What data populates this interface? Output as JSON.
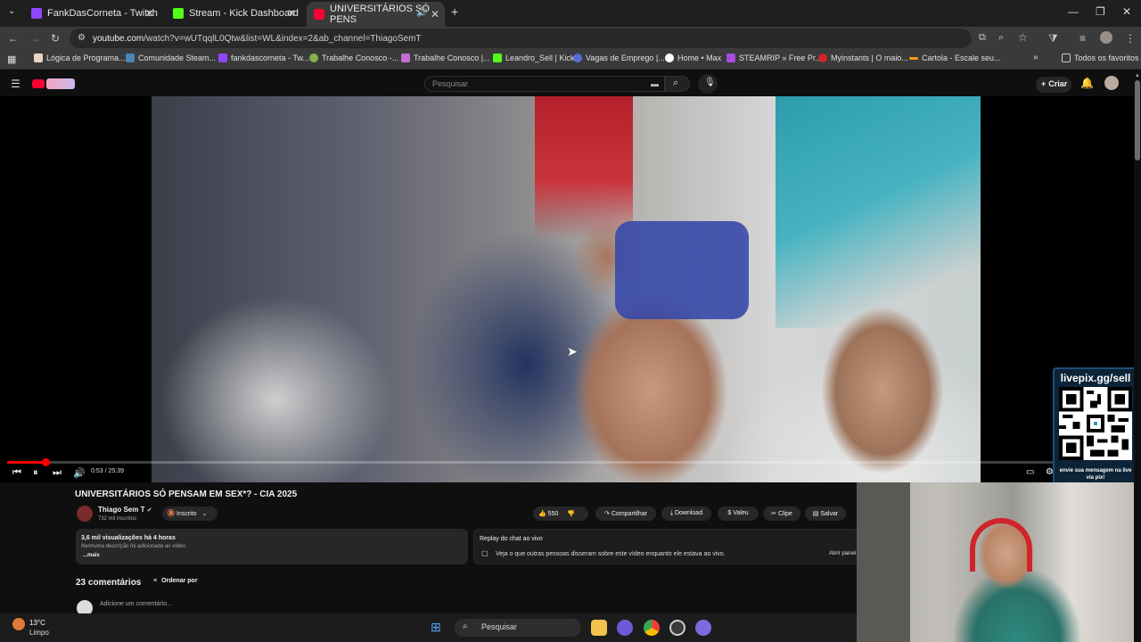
{
  "browser": {
    "tabs": [
      {
        "title": "FankDasCorneta - Twitch",
        "color": "#9146ff"
      },
      {
        "title": "Stream - Kick Dashboard",
        "color": "#53fc18"
      },
      {
        "title": "UNIVERSITÁRIOS SÓ PENS",
        "color": "#ff0033"
      }
    ],
    "new_tab": "+",
    "url_host": "youtube.com",
    "url_path": "/watch?v=wUTqqlL0Qtw&list=WL&index=2&ab_channel=ThiagoSemT",
    "bookmarks": [
      {
        "label": "Lógica de Programa...",
        "color": "#e6d8c0"
      },
      {
        "label": "Comunidade Steam...",
        "color": "#4b86b4"
      },
      {
        "label": "fankdascorneta - Tw...",
        "color": "#9146ff"
      },
      {
        "label": "Trabalhe Conosco -...",
        "color": "#7fb347"
      },
      {
        "label": "Trabalhe Conosco |...",
        "color": "#c26fd0"
      },
      {
        "label": "Leandro_Sell | Kick",
        "color": "#53fc18"
      },
      {
        "label": "Vagas de Emprego |...",
        "color": "#5b6bd6"
      },
      {
        "label": "Home • Max",
        "color": "#ffffff"
      },
      {
        "label": "STEAMRIP » Free Pr...",
        "color": "#a64de0"
      },
      {
        "label": "Myinstants | O maio...",
        "color": "#d0242a"
      },
      {
        "label": "Cartola - Escale seu...",
        "color": "#f39c12"
      }
    ],
    "all_bookmarks": "Todos os favoritos"
  },
  "youtube": {
    "search_placeholder": "Pesquisar",
    "create_label": "Criar"
  },
  "player": {
    "time": "0:53 / 25:39",
    "progress": 0.034
  },
  "overlay": {
    "livepix_title": "livepix.gg/sell",
    "livepix_sub": "envie sua mensagem na live via pix!"
  },
  "video": {
    "title": "UNIVERSITÁRIOS SÓ PENSAM EM SEX*? - CIA 2025",
    "channel": "Thiago Sem T",
    "subscribers": "732 mil inscritos",
    "subscribed_label": "Inscrito",
    "likes": "550",
    "share": "Compartilhar",
    "download": "Download",
    "thanks": "Valeu",
    "clip": "Clipe",
    "save": "Salvar",
    "views_time": "3,6 mil visualizações  há 4 horas",
    "description": "Nenhuma descrição foi adicionada ao vídeo.",
    "more": "...mais",
    "chat_replay_title": "Replay do chat ao vivo",
    "chat_replay_text": "Veja o que outras pessoas disseram sobre este vídeo enquanto ele estava ao vivo.",
    "open_panel": "Abrir painel",
    "comments_count": "23 comentários",
    "sort_by": "Ordenar por",
    "add_comment": "Adicione um comentário..."
  },
  "taskbar": {
    "temp": "13°C",
    "weather": "Limpo",
    "search": "Pesquisar"
  }
}
